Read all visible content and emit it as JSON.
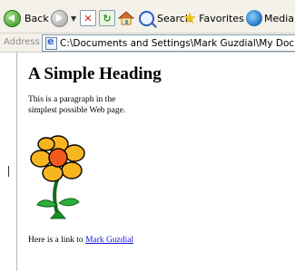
{
  "toolbar": {
    "back_label": "Back",
    "search_label": "Search",
    "favorites_label": "Favorites",
    "media_label": "Media"
  },
  "address": {
    "label": "Address",
    "value": "C:\\Documents and Settings\\Mark Guzdial\\My Documents\\simple.html"
  },
  "page": {
    "heading": "A Simple Heading",
    "paragraph": "This is a paragraph in the simplest possible Web page.",
    "link_prefix": "Here is a link to",
    "link_text": "Mark Guzdial"
  },
  "icons": [
    "back-icon",
    "forward-icon",
    "stop-icon",
    "refresh-icon",
    "home-icon",
    "search-icon",
    "favorites-star-icon",
    "media-icon",
    "page-icon",
    "flower-image"
  ],
  "colors": {
    "toolbar_bg": "#f3f1e9",
    "link": "#1212d8",
    "back_green": "#2f8c1b"
  }
}
